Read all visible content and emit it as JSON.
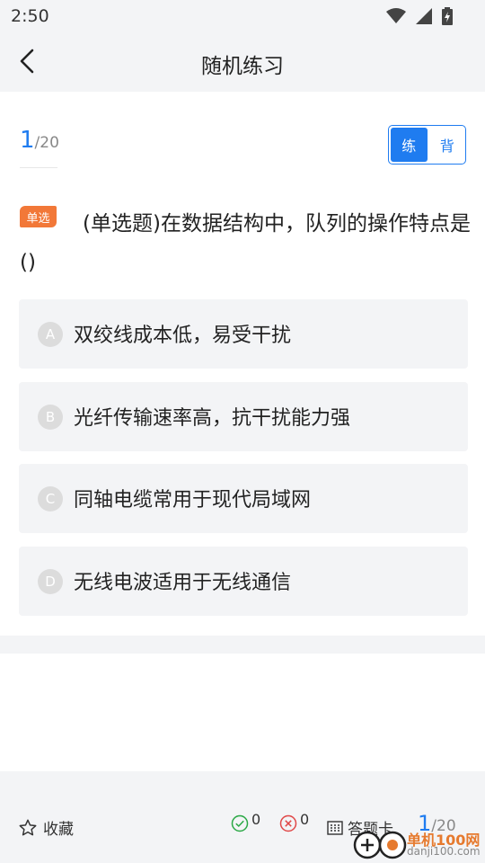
{
  "status_bar": {
    "time": "2:50",
    "icons": [
      "wifi-icon",
      "signal-icon",
      "battery-icon"
    ]
  },
  "nav": {
    "title": "随机练习",
    "back_icon": "chevron-left-icon"
  },
  "progress": {
    "current": "1",
    "total": "/20"
  },
  "mode_toggle": {
    "practice": "练",
    "recite": "背",
    "active": "practice"
  },
  "question": {
    "tag": "单选",
    "text": "(单选题)在数据结构中，队列的操作特点是()"
  },
  "options": [
    {
      "letter": "A",
      "text": "双绞线成本低，易受干扰"
    },
    {
      "letter": "B",
      "text": "光纤传输速率高，抗干扰能力强"
    },
    {
      "letter": "C",
      "text": "同轴电缆常用于现代局域网"
    },
    {
      "letter": "D",
      "text": "无线电波适用于无线通信"
    }
  ],
  "bottom_bar": {
    "favorite_label": "收藏",
    "correct_count": "0",
    "wrong_count": "0",
    "answer_card_label": "答题卡",
    "current": "1",
    "total": "/20"
  },
  "watermark": {
    "line1": "单机100网",
    "line2": "danji100.com"
  },
  "colors": {
    "accent": "#1f7cf0",
    "tag": "#f27838",
    "background_gray": "#f3f4f6",
    "correct": "#2aa845",
    "wrong": "#e04848"
  }
}
